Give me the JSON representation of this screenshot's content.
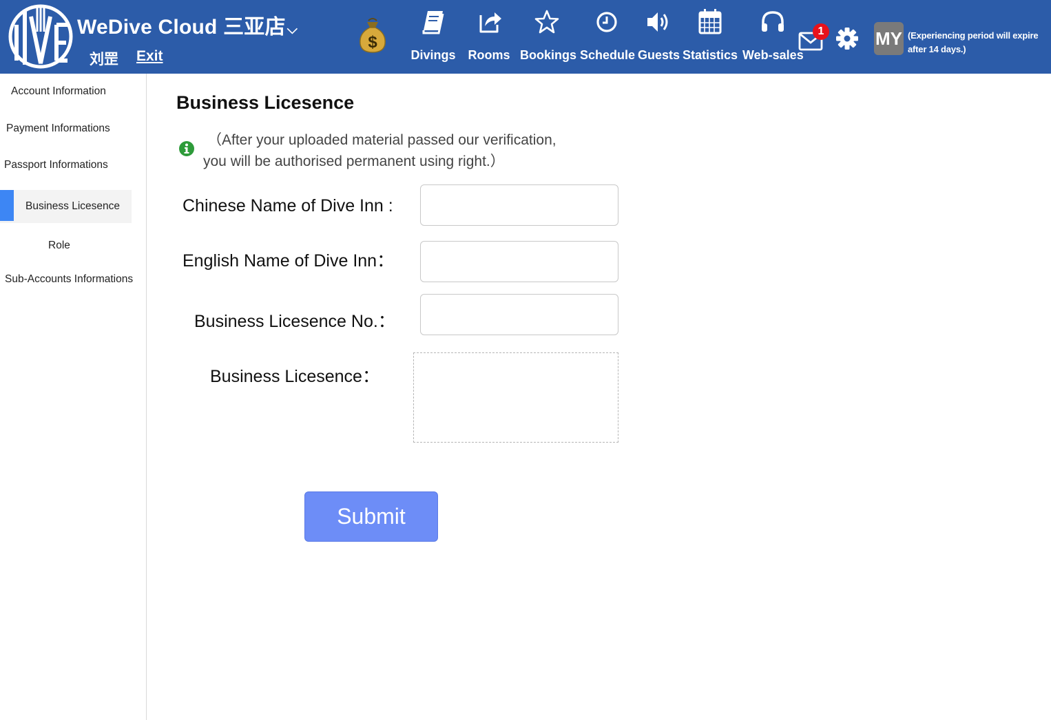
{
  "header": {
    "brand": "WeDive Cloud 三亚店",
    "brand_caret": "⌵",
    "user_name": "刘罡",
    "exit_label": "Exit",
    "nav": [
      {
        "label": "Divings",
        "icon": "book-icon"
      },
      {
        "label": "Rooms",
        "icon": "share-icon"
      },
      {
        "label": "Bookings",
        "icon": "star-icon"
      },
      {
        "label": "Schedule",
        "icon": "clock-icon"
      },
      {
        "label": "Guests",
        "icon": "speaker-icon"
      },
      {
        "label": "Statistics",
        "icon": "calendar-icon"
      },
      {
        "label": "Web-sales",
        "icon": "headphones-icon"
      }
    ],
    "mail_badge": "1",
    "avatar_text": "MY",
    "trial_notice": "(Experiencing period will expire after 14 days.)",
    "bar_color": "#2c5ca9"
  },
  "sidebar": {
    "items": [
      {
        "label": "Account Information"
      },
      {
        "label": "Payment Informations"
      },
      {
        "label": "Passport Informations"
      },
      {
        "label": "Business Licesence",
        "active": true
      },
      {
        "label": "Role"
      },
      {
        "label": "Sub-Accounts Informations"
      }
    ],
    "active_color": "#3d86f4"
  },
  "main": {
    "title": "Business Licesence",
    "info_line1": "（After your uploaded material passed our verification,",
    "info_line2": "you will be authorised permanent using right.）",
    "fields": {
      "chinese_name_label": "Chinese Name of Dive Inn :",
      "english_name_label": "English Name of Dive Inn：",
      "licence_no_label": "Business Licesence No.：",
      "licence_upload_label": "Business Licesence："
    },
    "submit_label": "Submit",
    "submit_color": "#6d8df7"
  }
}
